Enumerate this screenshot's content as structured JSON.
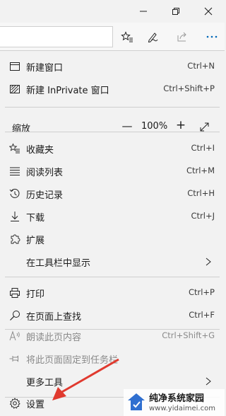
{
  "window": {
    "controls": [
      "minimize-icon",
      "restore-icon",
      "close-icon"
    ]
  },
  "toolbar": {
    "icons": [
      "favorites-icon",
      "pen-icon",
      "share-icon",
      "more-icon"
    ]
  },
  "menu": {
    "new_window": {
      "label": "新建窗口",
      "shortcut": "Ctrl+N"
    },
    "new_inprivate": {
      "label": "新建 InPrivate 窗口",
      "shortcut": "Ctrl+Shift+P"
    },
    "zoom": {
      "label": "缩放",
      "value": "100%",
      "minus": "—",
      "plus": "+"
    },
    "favorites": {
      "label": "收藏夹",
      "shortcut": "Ctrl+I"
    },
    "reading_list": {
      "label": "阅读列表",
      "shortcut": "Ctrl+M"
    },
    "history": {
      "label": "历史记录",
      "shortcut": "Ctrl+H"
    },
    "downloads": {
      "label": "下载",
      "shortcut": "Ctrl+J"
    },
    "extensions": {
      "label": "扩展"
    },
    "show_in_toolbar": {
      "label": "在工具栏中显示"
    },
    "print": {
      "label": "打印",
      "shortcut": "Ctrl+P"
    },
    "find": {
      "label": "在页面上查找",
      "shortcut": "Ctrl+F"
    },
    "read_aloud": {
      "label": "朗读此页内容",
      "shortcut": "Ctrl+Shift+G"
    },
    "pin": {
      "label": "将此页面固定到任务栏"
    },
    "more_tools": {
      "label": "更多工具"
    },
    "settings": {
      "label": "设置"
    }
  },
  "watermark": {
    "title": "纯净系统家园",
    "url": "www.yidaimei.com"
  },
  "colors": {
    "accent": "#0067b8",
    "annotation_arrow": "#e03a2f"
  }
}
